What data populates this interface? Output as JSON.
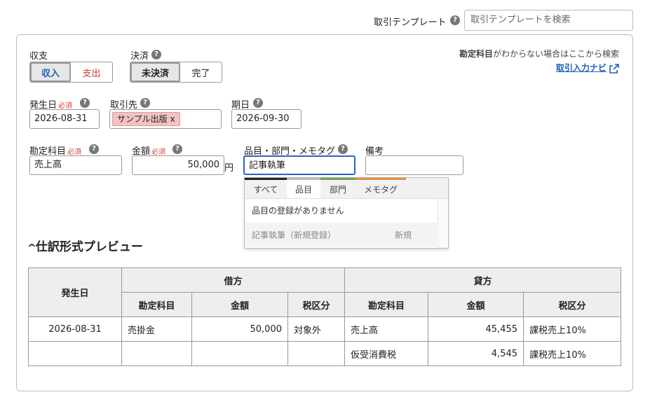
{
  "template": {
    "label": "取引テンプレート",
    "search_placeholder": "取引テンプレートを検索"
  },
  "income_expense": {
    "label": "収支",
    "options": [
      "収入",
      "支出"
    ],
    "selected": "収入"
  },
  "settlement": {
    "label": "決済",
    "options": [
      "未決済",
      "完了"
    ],
    "selected": "未決済"
  },
  "help_link": {
    "text_bold": "勘定科目",
    "text_rest": "がわからない場合はここから検索",
    "link_label": "取引入力ナビ"
  },
  "fields": {
    "occurrence_date": {
      "label": "発生日",
      "required": "必須",
      "value": "2026-08-31"
    },
    "partner": {
      "label": "取引先",
      "tag": "サンプル出版",
      "tag_remove": "x"
    },
    "due_date": {
      "label": "期日",
      "value": "2026-09-30"
    },
    "account": {
      "label": "勘定科目",
      "required": "必須",
      "value": "売上高"
    },
    "amount": {
      "label": "金額",
      "required": "必須",
      "value": "50,000",
      "unit": "円"
    },
    "item_tags": {
      "label": "品目・部門・メモタグ",
      "value": "記事執筆"
    },
    "remarks": {
      "label": "備考",
      "value": ""
    }
  },
  "dropdown": {
    "tabs": [
      "すべて",
      "品目",
      "部門",
      "メモタグ"
    ],
    "active_tab": "品目",
    "tab_colors": [
      "#222222",
      "#bbbbbb",
      "#6aa84f",
      "#e69138"
    ],
    "empty_message": "品目の登録がありません",
    "new_item": "記事執筆（新規登録）",
    "new_label": "新規"
  },
  "preview": {
    "title": "仕訳形式プレビュー",
    "col_date": "発生日",
    "debit": "借方",
    "credit": "貸方",
    "sub_headers": [
      "勘定科目",
      "金額",
      "税区分",
      "勘定科目",
      "金額",
      "税区分"
    ],
    "rows": [
      {
        "date": "2026-08-31",
        "d_account": "売掛金",
        "d_amount": "50,000",
        "d_tax": "対象外",
        "c_account": "売上高",
        "c_amount": "45,455",
        "c_tax": "課税売上10%"
      },
      {
        "date": "",
        "d_account": "",
        "d_amount": "",
        "d_tax": "",
        "c_account": "仮受消費税",
        "c_amount": "4,545",
        "c_tax": "課税売上10%"
      }
    ]
  },
  "colors": {
    "accent_blue": "#1f5fb8",
    "expense_red": "#d93a3a",
    "tag_pink": "#f3c3c3"
  }
}
